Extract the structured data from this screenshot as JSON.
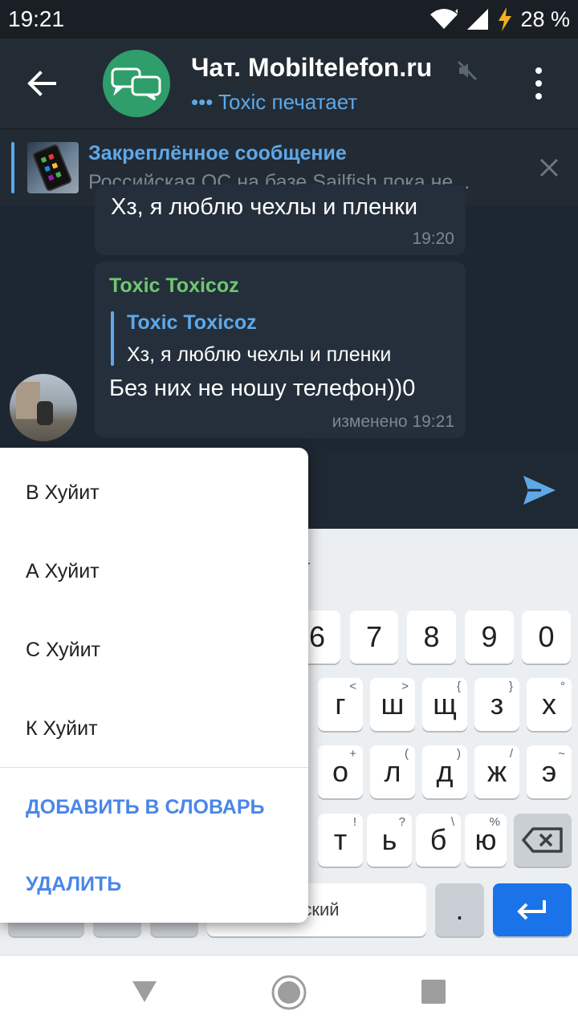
{
  "status_bar": {
    "time": "19:21",
    "battery": "28 %"
  },
  "header": {
    "title": "Чат. Mobiltelefon.ru",
    "status": "••• Toxic печатает",
    "icons": [
      "back-arrow-icon",
      "chat-bubbles-icon",
      "mute-icon",
      "more-vert-icon"
    ]
  },
  "pinned": {
    "title": "Закреплённое сообщение",
    "text": "Российская ОС на базе Sailfish пока не..."
  },
  "messages": [
    {
      "text": "Хз, я люблю чехлы и пленки",
      "time": "19:20"
    },
    {
      "sender": "Toxic Toxicoz",
      "reply_name": "Toxic Toxicoz",
      "reply_text": "Хз, я люблю чехлы и пленки",
      "text": "Без них не ношу телефон))0",
      "time": "изменено 19:21"
    }
  ],
  "popup": {
    "items": [
      "В Хуйит",
      "А Хуйит",
      "С Хуйит",
      "К Хуйит"
    ],
    "add_to_dictionary": "ДОБАВИТЬ В СЛОВАРЬ",
    "delete": "УДАЛИТЬ"
  },
  "keyboard": {
    "suggestion": "ит",
    "row1": [
      "6",
      "7",
      "8",
      "9",
      "0"
    ],
    "row2": [
      {
        "label": "г",
        "hint": "<"
      },
      {
        "label": "ш",
        "hint": ">"
      },
      {
        "label": "щ",
        "hint": "{"
      },
      {
        "label": "з",
        "hint": "}"
      },
      {
        "label": "х",
        "hint": "°"
      }
    ],
    "row3": [
      {
        "label": "о",
        "hint": "+"
      },
      {
        "label": "л",
        "hint": "("
      },
      {
        "label": "д",
        "hint": ")"
      },
      {
        "label": "ж",
        "hint": "/"
      },
      {
        "label": "э",
        "hint": "~"
      }
    ],
    "row4": [
      {
        "label": "т",
        "hint": "!"
      },
      {
        "label": "ь",
        "hint": "?"
      },
      {
        "label": "б",
        "hint": "\\"
      },
      {
        "label": "ю",
        "hint": "%"
      }
    ],
    "comma": ",",
    "space": "сский",
    "period": "."
  }
}
